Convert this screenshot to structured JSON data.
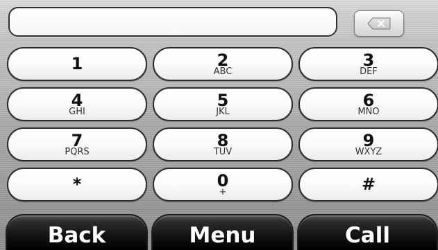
{
  "display": {
    "value": ""
  },
  "backspace": {
    "icon": "backspace-icon"
  },
  "keypad": {
    "keys": [
      {
        "main": "1",
        "sub": ""
      },
      {
        "main": "2",
        "sub": "ABC"
      },
      {
        "main": "3",
        "sub": "DEF"
      },
      {
        "main": "4",
        "sub": "GHI"
      },
      {
        "main": "5",
        "sub": "JKL"
      },
      {
        "main": "6",
        "sub": "MNO"
      },
      {
        "main": "7",
        "sub": "PQRS"
      },
      {
        "main": "8",
        "sub": "TUV"
      },
      {
        "main": "9",
        "sub": "WXYZ"
      },
      {
        "main": "*",
        "sub": ""
      },
      {
        "main": "0",
        "sub": "+"
      },
      {
        "main": "#",
        "sub": ""
      }
    ]
  },
  "footer": {
    "back_label": "Back",
    "menu_label": "Menu",
    "call_label": "Call"
  }
}
